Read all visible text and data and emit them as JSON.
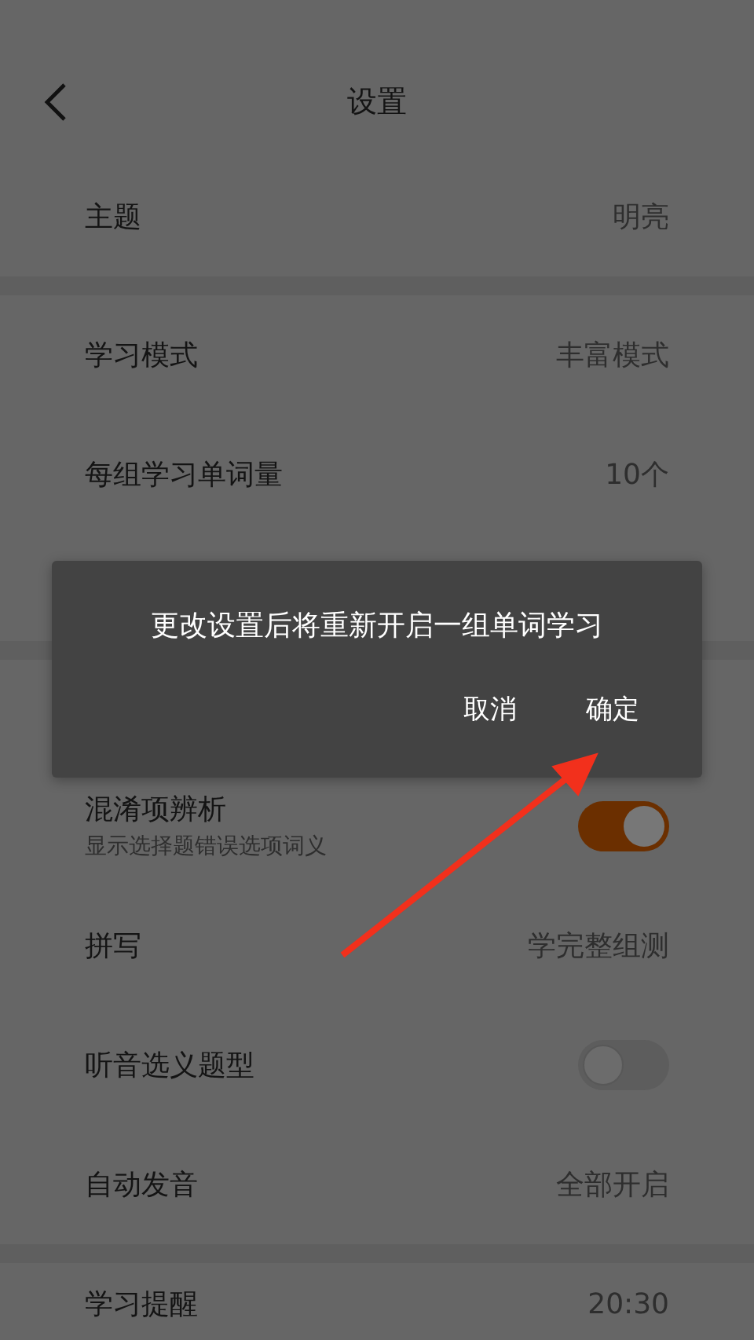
{
  "header": {
    "title": "设置"
  },
  "sections": [
    {
      "items": [
        {
          "kind": "value",
          "label": "主题",
          "value": "明亮"
        }
      ]
    },
    {
      "items": [
        {
          "kind": "value",
          "label": "学习模式",
          "value": "丰富模式"
        },
        {
          "kind": "value",
          "label": "每组学习单词量",
          "value": "10个"
        }
      ]
    },
    {
      "items": [
        {
          "kind": "toggle",
          "label": "混淆项辨析",
          "subtitle": "显示选择题错误选项词义",
          "on": true
        },
        {
          "kind": "value",
          "label": "拼写",
          "value": "学完整组测"
        },
        {
          "kind": "toggle",
          "label": "听音选义题型",
          "on": false
        },
        {
          "kind": "value",
          "label": "自动发音",
          "value": "全部开启"
        }
      ]
    },
    {
      "items": [
        {
          "kind": "value",
          "label": "学习提醒",
          "value": "20:30"
        }
      ]
    }
  ],
  "dialog": {
    "message": "更改设置后将重新开启一组单词学习",
    "buttons": [
      {
        "label": "取消"
      },
      {
        "label": "确定"
      }
    ]
  }
}
